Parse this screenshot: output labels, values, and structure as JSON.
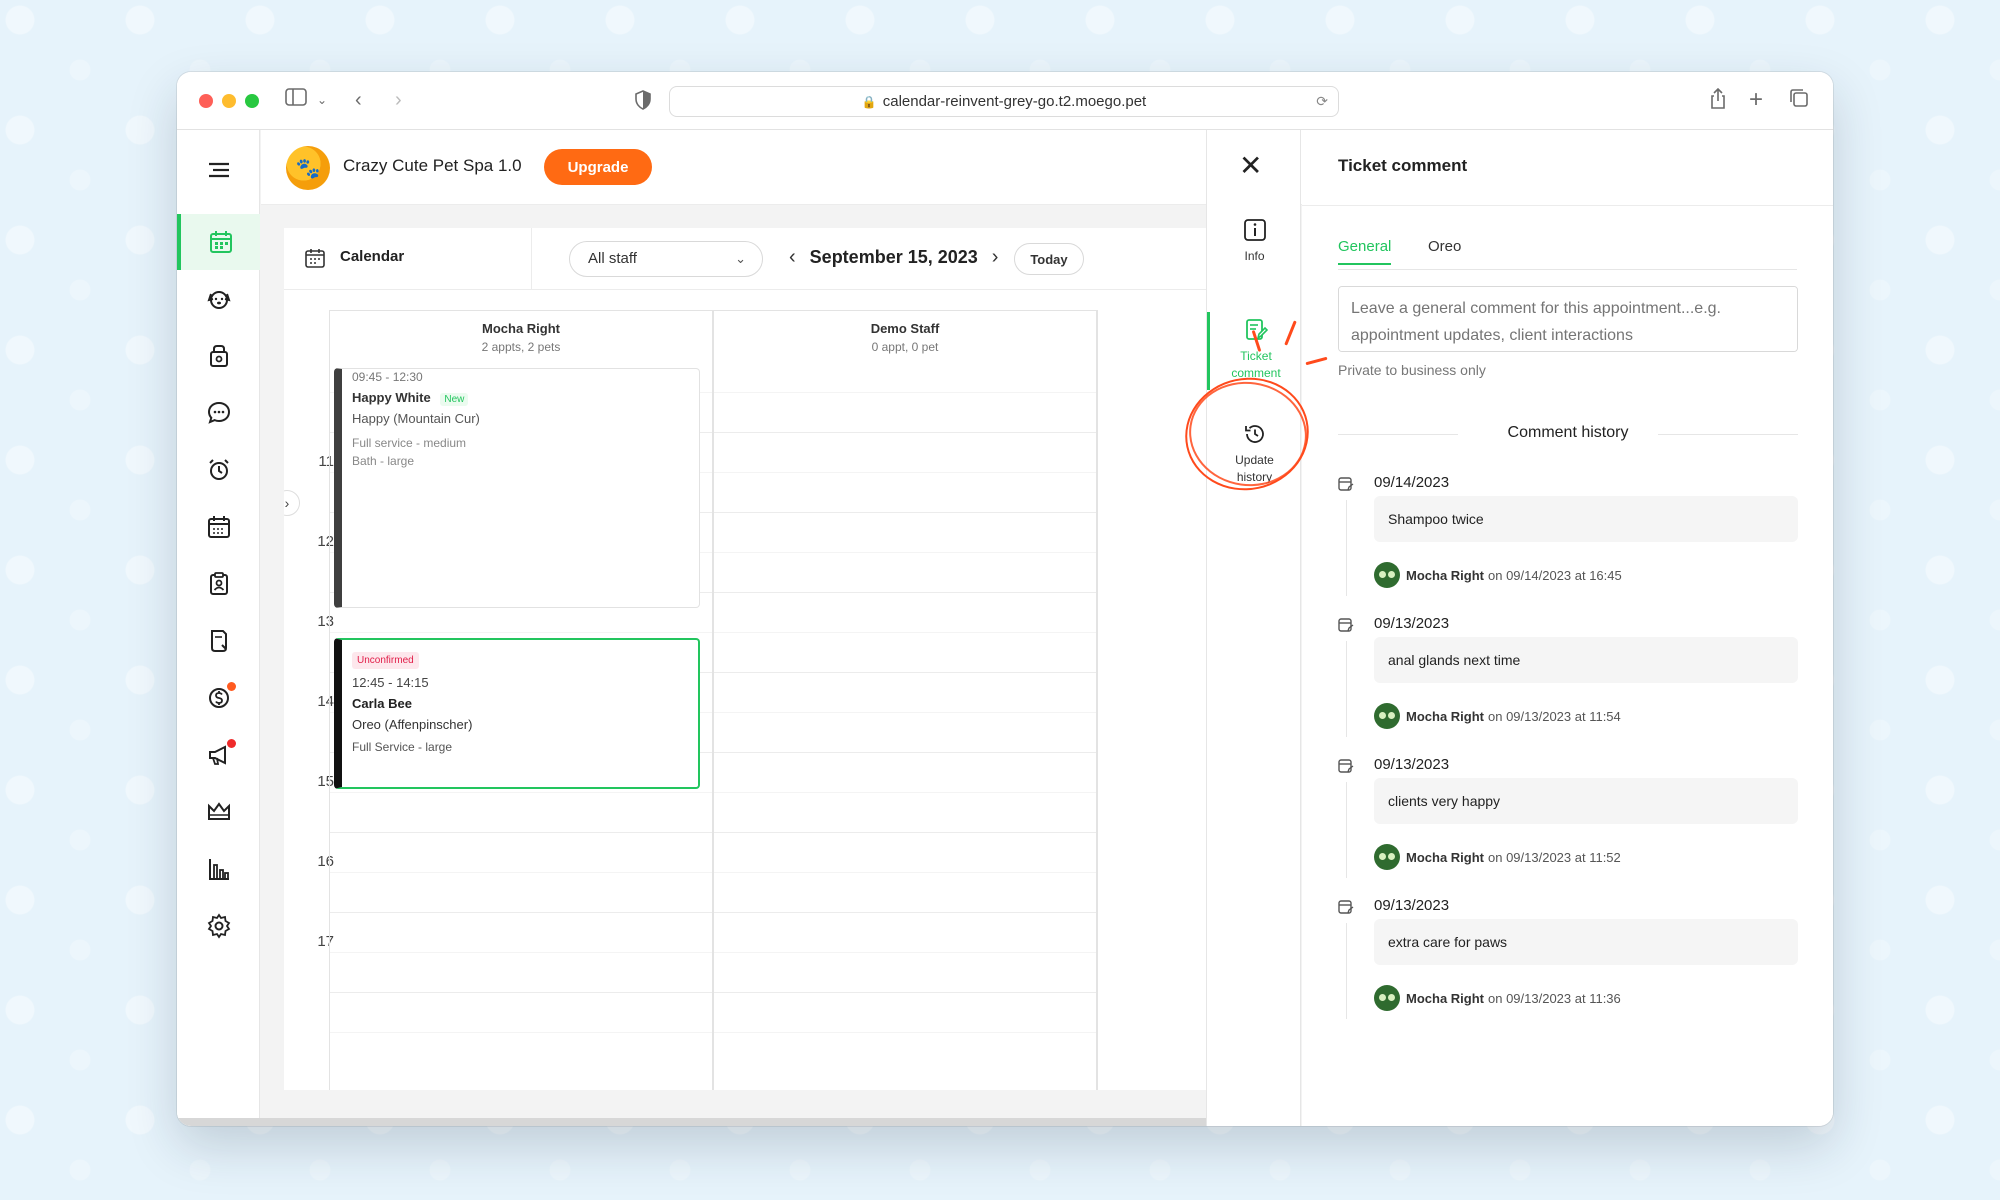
{
  "browser": {
    "url": "calendar-reinvent-grey-go.t2.moego.pet"
  },
  "header": {
    "business_name": "Crazy Cute Pet Spa 1.0",
    "upgrade_label": "Upgrade"
  },
  "calendar": {
    "title": "Calendar",
    "staff_filter": "All staff",
    "date": "September 15, 2023",
    "today_label": "Today",
    "columns": [
      {
        "name": "Mocha Right",
        "meta": "2 appts, 2 pets"
      },
      {
        "name": "Demo Staff",
        "meta": "0 appt, 0 pet"
      }
    ],
    "hours": [
      "11",
      "12",
      "13",
      "14",
      "15",
      "16",
      "17"
    ],
    "appointments": [
      {
        "time": "09:45 - 12:30",
        "client": "Happy White",
        "badge": "New",
        "pet": "Happy (Mountain Cur)",
        "services": [
          "Full service - medium",
          "Bath - large"
        ]
      },
      {
        "status": "Unconfirmed",
        "time": "12:45 - 14:15",
        "client": "Carla Bee",
        "pet": "Oreo (Affenpinscher)",
        "services": [
          "Full Service - large"
        ]
      }
    ]
  },
  "rail": {
    "info_label": "Info",
    "ticket_comment_label_1": "Ticket",
    "ticket_comment_label_2": "comment",
    "update_history_label_1": "Update",
    "update_history_label_2": "history"
  },
  "comment_panel": {
    "title": "Ticket comment",
    "tabs": [
      "General",
      "Oreo"
    ],
    "placeholder": "Leave a general comment for this appointment...e.g. appointment updates, client interactions",
    "private_note": "Private to business only",
    "history_title": "Comment history",
    "entries": [
      {
        "date": "09/14/2023",
        "text": "Shampoo twice",
        "author": "Mocha Right",
        "meta": "on 09/14/2023 at 16:45"
      },
      {
        "date": "09/13/2023",
        "text": "anal glands next time",
        "author": "Mocha Right",
        "meta": "on 09/13/2023 at 11:54"
      },
      {
        "date": "09/13/2023",
        "text": "clients very happy",
        "author": "Mocha Right",
        "meta": "on 09/13/2023 at 11:52"
      },
      {
        "date": "09/13/2023",
        "text": "extra care for paws",
        "author": "Mocha Right",
        "meta": "on 09/13/2023 at 11:36"
      }
    ]
  },
  "colors": {
    "accent_green": "#22c55e",
    "upgrade_orange": "#ff6a13",
    "annotation_red": "#ff4a1c"
  },
  "icons": {
    "nav": [
      "menu-icon",
      "calendar-icon",
      "pet-icon",
      "shop-icon",
      "chat-icon",
      "alarm-icon",
      "schedule-icon",
      "clipboard-icon",
      "document-icon",
      "payment-icon",
      "megaphone-icon",
      "crown-icon",
      "chart-icon",
      "gear-icon"
    ]
  }
}
